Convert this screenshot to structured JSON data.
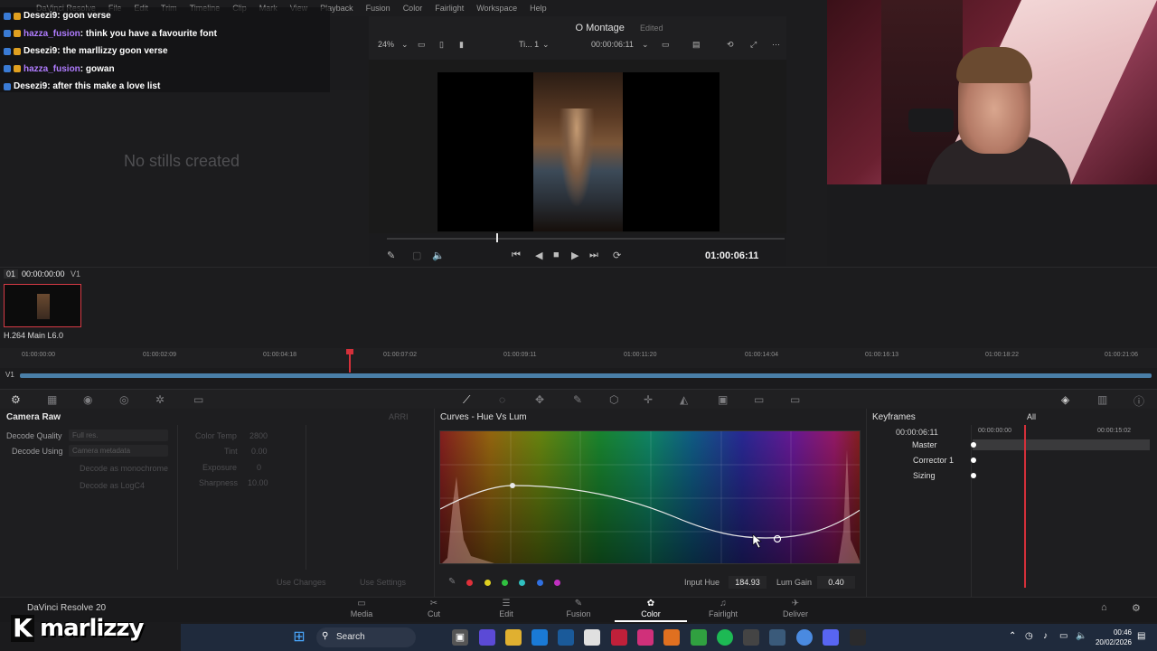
{
  "menubar": {
    "items": [
      "DaVinci Resolve",
      "File",
      "Edit",
      "Trim",
      "Timeline",
      "Clip",
      "Mark",
      "View",
      "Playback",
      "Fusion",
      "Color",
      "Fairlight",
      "Workspace",
      "Help"
    ]
  },
  "chat": {
    "messages": [
      {
        "user": "Desezi9",
        "text": ": goon verse",
        "color": "#ffffff"
      },
      {
        "user": "hazza_fusion",
        "text": ": think you have a favourite font",
        "color": "#b07cff"
      },
      {
        "user": "Desezi9",
        "text": ": the marllizzy goon verse",
        "color": "#ffffff"
      },
      {
        "user": "hazza_fusion",
        "text": ": gowan",
        "color": "#b07cff"
      },
      {
        "user": "Desezi9",
        "text": ": after this make a love list",
        "color": "#ffffff"
      }
    ]
  },
  "stills": {
    "empty_text": "No stills created"
  },
  "viewer": {
    "project_title": "O Montage",
    "edited_label": "Edited",
    "zoom": "24%",
    "timeline_name": "Ti... 1",
    "timecode_top": "00:00:06:11",
    "timecode_main": "01:00:06:11"
  },
  "clip": {
    "number": "01",
    "timecode": "00:00:00:00",
    "track": "V1",
    "codec": "H.264 Main L6.0"
  },
  "ruler": {
    "ticks": [
      "01:00:00:00",
      "01:00:02:09",
      "01:00:04:18",
      "01:00:07:02",
      "01:00:09:11",
      "01:00:11:20",
      "01:00:14:04",
      "01:00:16:13",
      "01:00:18:22",
      "01:00:21:06"
    ],
    "track_label": "V1"
  },
  "camera_raw": {
    "title": "Camera Raw",
    "arri_label": "ARRI",
    "decode_quality_label": "Decode Quality",
    "decode_quality_value": "Full res.",
    "decode_using_label": "Decode Using",
    "decode_using_value": "Camera metadata",
    "mono_label": "Decode as monochrome",
    "logc4_label": "Decode as LogC4",
    "color_temp_label": "Color Temp",
    "color_temp_value": "2800",
    "tint_label": "Tint",
    "tint_value": "0.00",
    "exposure_label": "Exposure",
    "exposure_value": "0",
    "sharpness_label": "Sharpness",
    "sharpness_value": "10.00",
    "use_changes": "Use Changes",
    "use_settings": "Use Settings"
  },
  "curves": {
    "title": "Curves - Hue Vs Lum",
    "input_hue_label": "Input Hue",
    "input_hue_value": "184.93",
    "lum_gain_label": "Lum Gain",
    "lum_gain_value": "0.40",
    "swatch_colors": [
      "#e0303a",
      "#e0d020",
      "#30c040",
      "#30c0c0",
      "#3070e0",
      "#c030c0"
    ]
  },
  "keyframes": {
    "title": "Keyframes",
    "filter": "All",
    "timecode": "00:00:06:11",
    "ruler_start": "00:00:00:00",
    "ruler_end": "00:00:15:02",
    "rows": [
      "Master",
      "Corrector 1",
      "Sizing"
    ]
  },
  "bottom_nav": {
    "app_name": "DaVinci Resolve 20",
    "pages": [
      "Media",
      "Cut",
      "Edit",
      "Fusion",
      "Color",
      "Fairlight",
      "Deliver"
    ],
    "active": "Color"
  },
  "overlay": {
    "logo_letter": "K",
    "channel_name": "marlizzy"
  },
  "taskbar": {
    "search_placeholder": "Search",
    "time": "00:46",
    "date": "20/02/2026"
  }
}
